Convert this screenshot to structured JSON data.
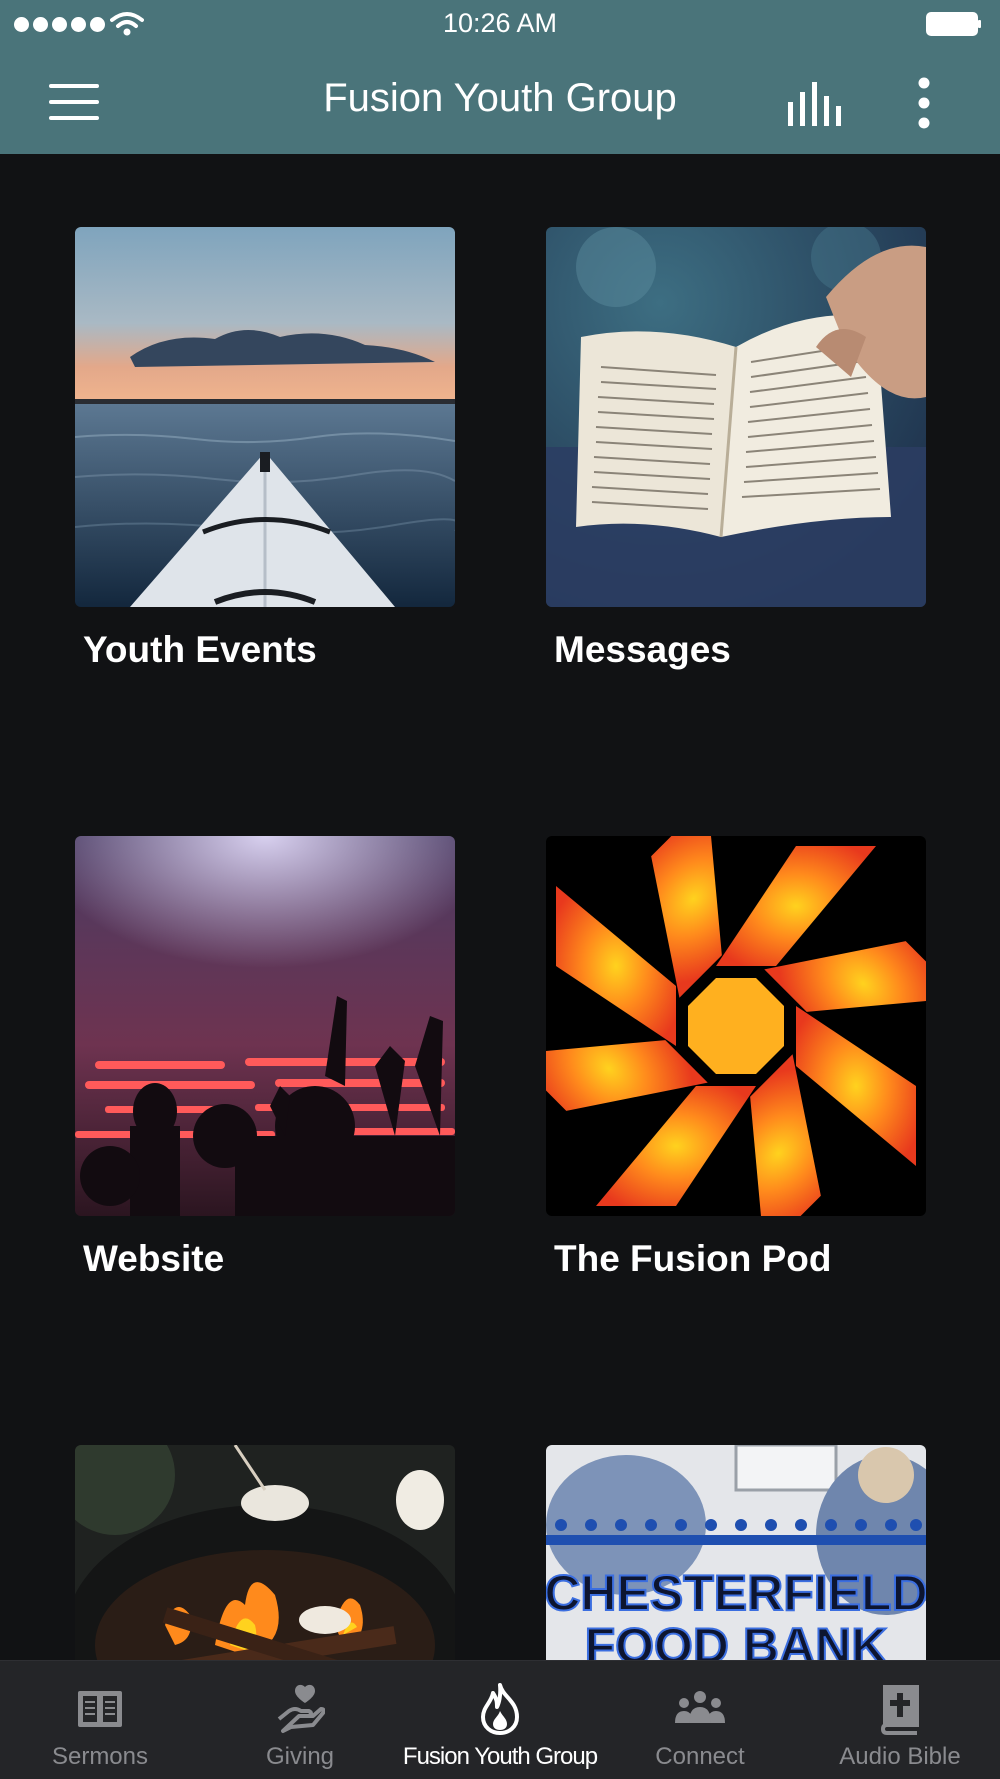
{
  "status_bar": {
    "time": "10:26 AM"
  },
  "header": {
    "title": "Fusion Youth Group"
  },
  "tiles": [
    {
      "label": "Youth Events"
    },
    {
      "label": "Messages"
    },
    {
      "label": "Website"
    },
    {
      "label": "The Fusion Pod"
    },
    {
      "label": ""
    },
    {
      "label": "",
      "image_text": "CHESTERFIELD",
      "image_text_2": "FOOD BANK"
    }
  ],
  "tab_bar": {
    "items": [
      {
        "label": "Sermons",
        "icon": "open-book-icon"
      },
      {
        "label": "Giving",
        "icon": "heart-hand-icon"
      },
      {
        "label": "Fusion Youth Group",
        "icon": "flame-icon",
        "active": true
      },
      {
        "label": "Connect",
        "icon": "people-icon"
      },
      {
        "label": "Audio Bible",
        "icon": "bible-cross-icon"
      }
    ]
  },
  "colors": {
    "header_bg": "#4a747a",
    "page_bg": "#111214",
    "tabbar_bg": "#242528",
    "inactive_tab": "#8a8b8f"
  }
}
